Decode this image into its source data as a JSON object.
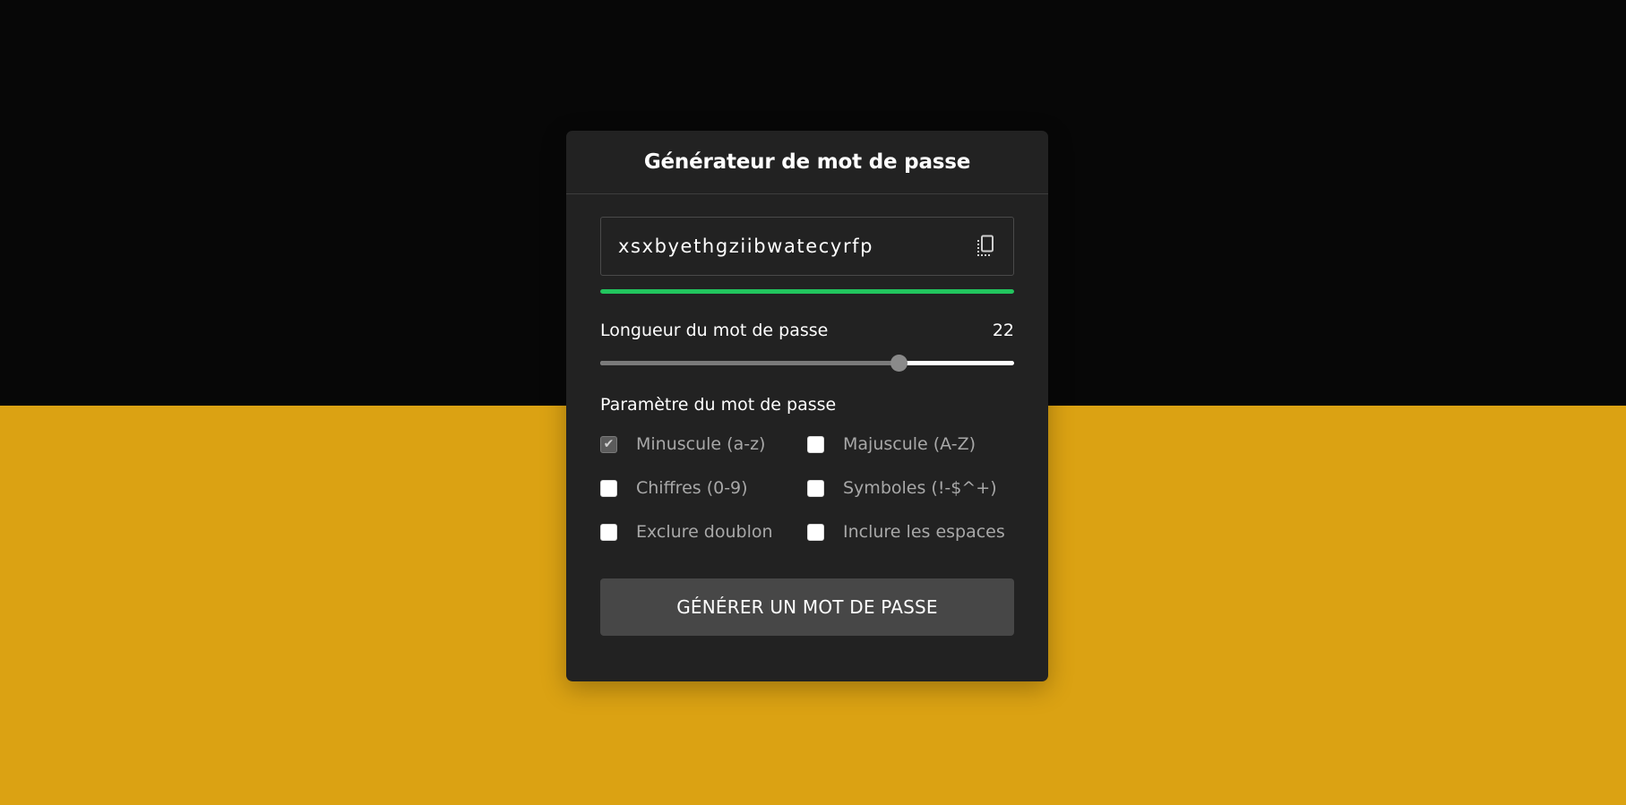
{
  "colors": {
    "background_top": "#070707",
    "background_bottom": "#dba213",
    "card": "#222222",
    "strength": "#22c55e",
    "button": "#474747"
  },
  "header": {
    "title": "Générateur de mot de passe"
  },
  "password": {
    "value": "xsxbyethgziibwatecyrfp",
    "copy_icon": "copy-icon",
    "strength_fraction": 1.0
  },
  "length": {
    "label": "Longueur du mot de passe",
    "value": "22",
    "slider_fraction": 0.72
  },
  "settings": {
    "title": "Paramètre du mot de passe",
    "options": [
      {
        "label": "Minuscule (a-z)",
        "checked": true
      },
      {
        "label": "Majuscule (A-Z)",
        "checked": false
      },
      {
        "label": "Chiffres (0-9)",
        "checked": false
      },
      {
        "label": "Symboles (!-$^+)",
        "checked": false
      },
      {
        "label": "Exclure doublon",
        "checked": false
      },
      {
        "label": "Inclure les espaces",
        "checked": false
      }
    ]
  },
  "actions": {
    "generate_label": "GÉNÉRER UN MOT DE PASSE"
  }
}
